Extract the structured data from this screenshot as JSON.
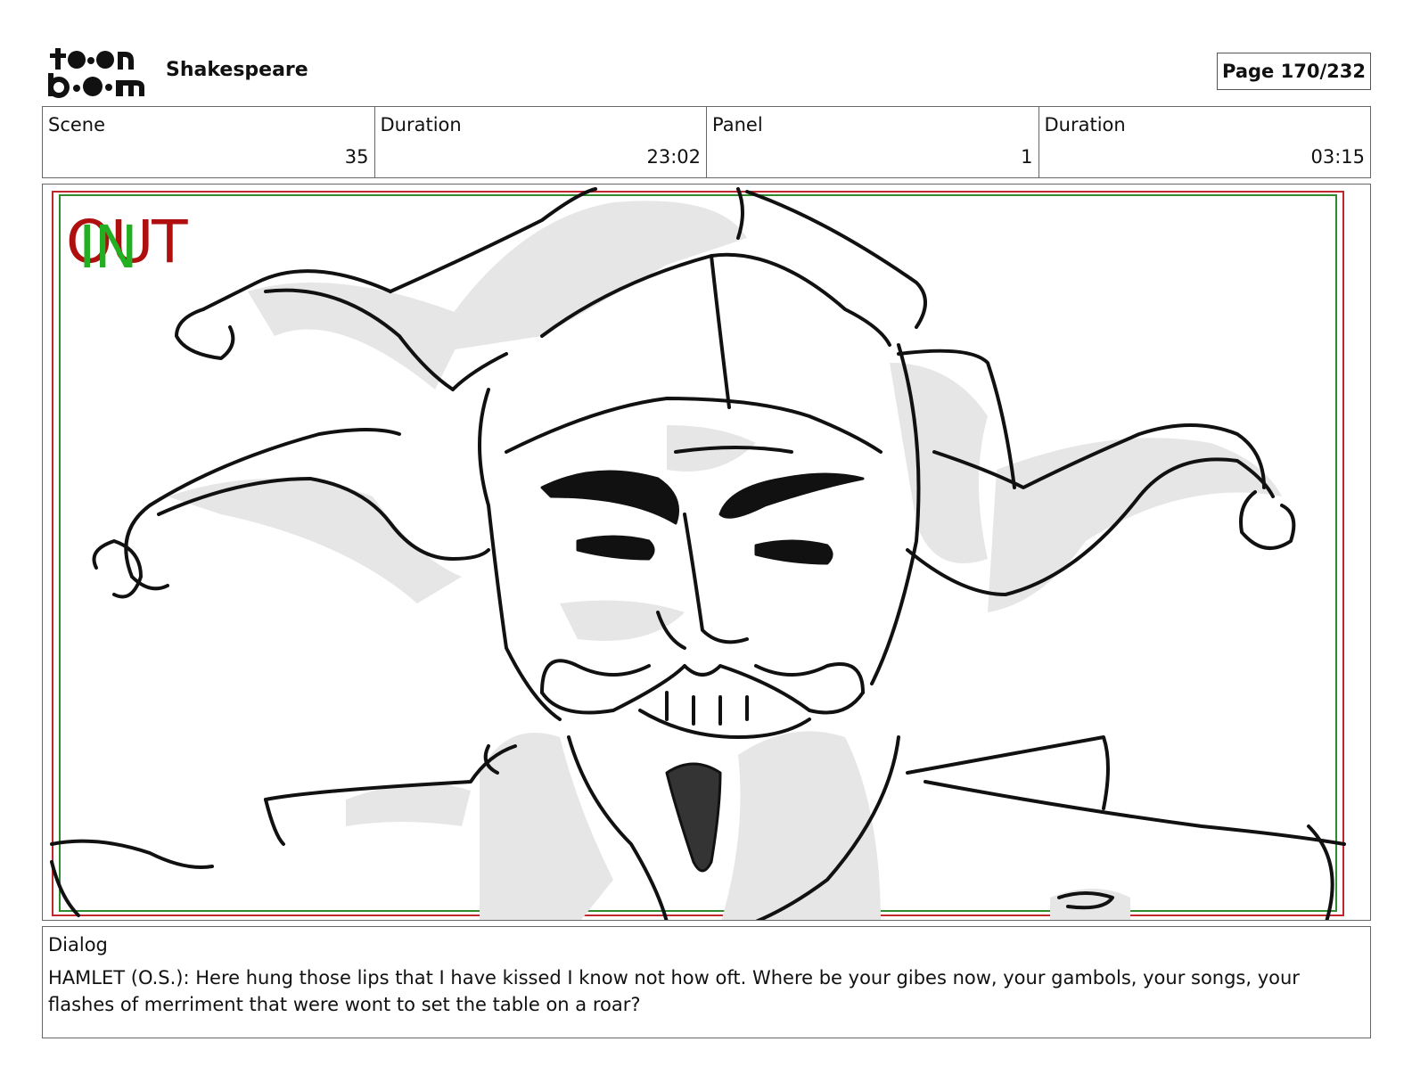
{
  "header": {
    "logo_text": "toon boom",
    "project_title": "Shakespeare",
    "page_label": "Page 170/232"
  },
  "info": [
    {
      "label": "Scene",
      "value": "35"
    },
    {
      "label": "Duration",
      "value": "23:02"
    },
    {
      "label": "Panel",
      "value": "1"
    },
    {
      "label": "Duration",
      "value": "03:15"
    }
  ],
  "panel": {
    "out_label": "OUT",
    "in_label": "IN",
    "illustration": "jester-sketch",
    "colors": {
      "out": "#b00f0f",
      "in": "#22b022",
      "safe_frame_red": "#c0262b",
      "safe_frame_green": "#2e8b2e",
      "shading": "#e6e6e6",
      "ink": "#111111"
    }
  },
  "dialog": {
    "label": "Dialog",
    "text": "HAMLET (O.S.): Here hung those lips that I have kissed I know not how oft.  Where be your gibes now, your gambols, your songs, your flashes of merriment that were wont to set the table on a roar?"
  }
}
